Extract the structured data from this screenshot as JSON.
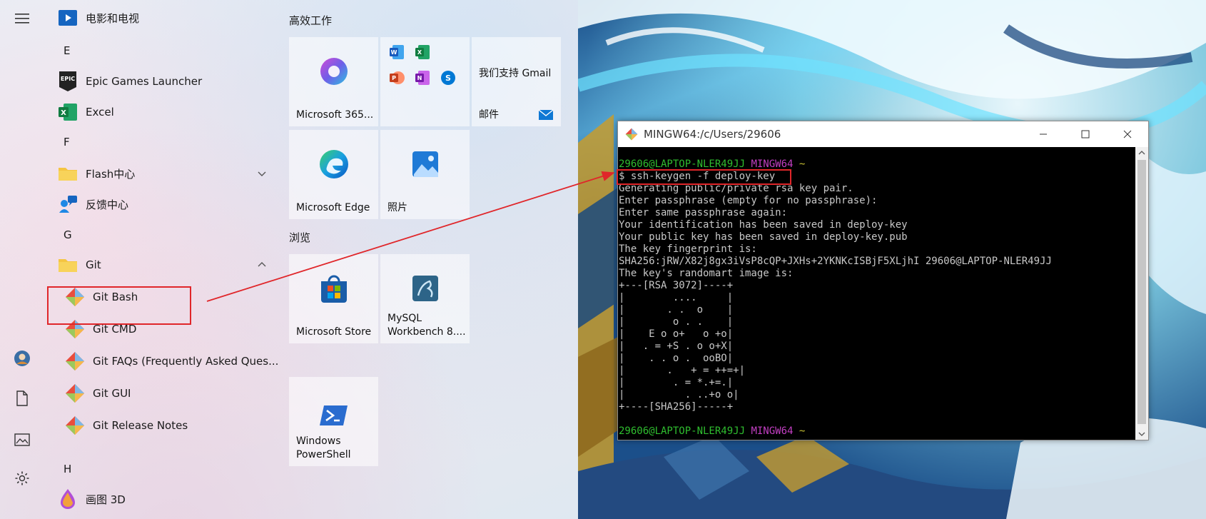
{
  "start_menu": {
    "rail": {
      "icons": [
        "hamburger-menu-icon",
        "user-avatar-icon",
        "documents-icon",
        "pictures-icon",
        "settings-icon"
      ]
    },
    "app_list": {
      "items": [
        {
          "type": "app",
          "label": "电影和电视",
          "icon": "movies-tv-icon"
        },
        {
          "type": "letter",
          "label": "E"
        },
        {
          "type": "app",
          "label": "Epic Games Launcher",
          "icon": "epic-games-icon"
        },
        {
          "type": "app",
          "label": "Excel",
          "icon": "excel-icon"
        },
        {
          "type": "letter",
          "label": "F"
        },
        {
          "type": "folder",
          "label": "Flash中心",
          "icon": "folder-icon",
          "expanded": false
        },
        {
          "type": "app",
          "label": "反馈中心",
          "icon": "feedback-hub-icon"
        },
        {
          "type": "letter",
          "label": "G"
        },
        {
          "type": "folder",
          "label": "Git",
          "icon": "folder-icon",
          "expanded": true
        },
        {
          "type": "subapp",
          "label": "Git Bash",
          "icon": "git-icon"
        },
        {
          "type": "subapp",
          "label": "Git CMD",
          "icon": "git-icon"
        },
        {
          "type": "subapp",
          "label": "Git FAQs (Frequently Asked Ques...",
          "icon": "git-icon"
        },
        {
          "type": "subapp",
          "label": "Git GUI",
          "icon": "git-icon"
        },
        {
          "type": "subapp",
          "label": "Git Release Notes",
          "icon": "git-icon"
        },
        {
          "type": "letter",
          "label": "H"
        },
        {
          "type": "app",
          "label": "画图 3D",
          "icon": "paint-3d-icon"
        }
      ]
    },
    "tiles": {
      "group_productivity": "高效工作",
      "group_browse": "浏览",
      "tile_m365": "Microsoft 365...",
      "tile_mail_top": "我们支持 Gmail",
      "tile_mail_bottom": "邮件",
      "tile_edge": "Microsoft Edge",
      "tile_photos": "照片",
      "tile_store": "Microsoft Store",
      "tile_mysql": "MySQL\nWorkbench 8....",
      "tile_powershell": "Windows\nPowerShell"
    }
  },
  "terminal": {
    "title": "MINGW64:/c/Users/29606",
    "prompt_user": "29606@LAPTOP-NLER49JJ",
    "prompt_env": "MINGW64",
    "prompt_path": "~",
    "command": "$ ssh-keygen -f deploy-key",
    "output": [
      "Generating public/private rsa key pair.",
      "Enter passphrase (empty for no passphrase):",
      "Enter same passphrase again:",
      "Your identification has been saved in deploy-key",
      "Your public key has been saved in deploy-key.pub",
      "The key fingerprint is:",
      "SHA256:jRW/X82j8gx3iVsP8cQP+JXHs+2YKNKcISBjF5XLjhI 29606@LAPTOP-NLER49JJ",
      "The key's randomart image is:",
      "+---[RSA 3072]----+",
      "|        ....     |",
      "|       . .  o    |",
      "|        o . .    |",
      "|    E o o+   o +o|",
      "|   . = +S . o o+X|",
      "|    . . o .  ooBO|",
      "|       .   + = ++=+|",
      "|        . = *.+=.|",
      "|          . ..+o o|",
      "+----[SHA256]-----+"
    ]
  },
  "colors": {
    "highlight": "#e0262a",
    "prompt_green": "#2fbe2f",
    "prompt_magenta": "#c23fc2",
    "prompt_yellow": "#c9c234"
  }
}
